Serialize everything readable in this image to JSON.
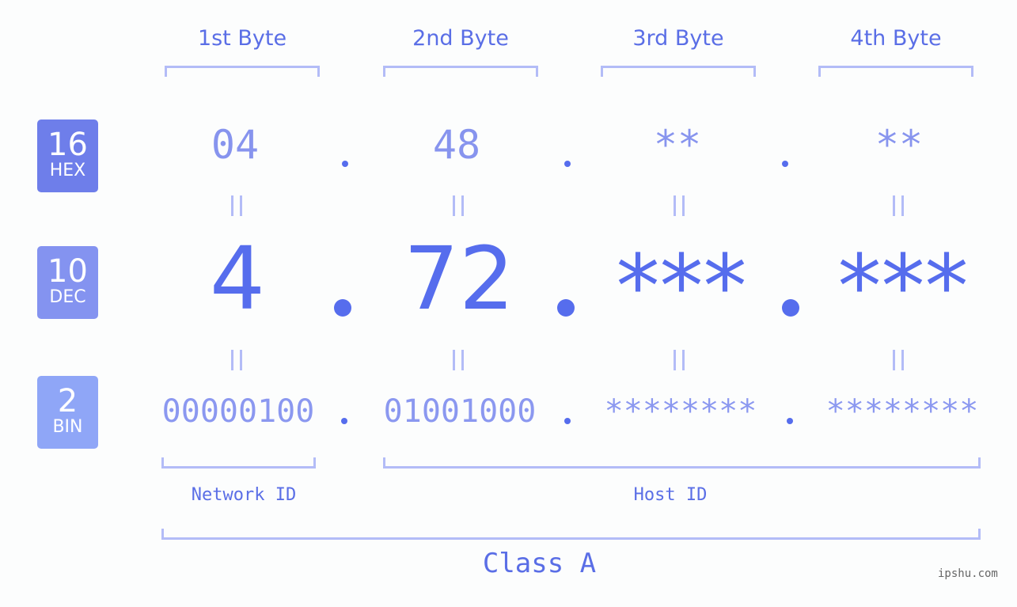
{
  "byte_headers": [
    "1st Byte",
    "2nd Byte",
    "3rd Byte",
    "4th Byte"
  ],
  "badges": {
    "hex": {
      "number": "16",
      "label": "HEX",
      "color": "#6e7eea"
    },
    "dec": {
      "number": "10",
      "label": "DEC",
      "color": "#8493f0"
    },
    "bin": {
      "number": "2",
      "label": "BIN",
      "color": "#8fa6f7"
    }
  },
  "hex_values": [
    "04",
    "48",
    "**",
    "**"
  ],
  "dec_values": [
    "4",
    "72",
    "***",
    "***"
  ],
  "bin_values": [
    "00000100",
    "01001000",
    "********",
    "********"
  ],
  "labels": {
    "network_id": "Network ID",
    "host_id": "Host ID",
    "class": "Class A"
  },
  "watermark": "ipshu.com",
  "colors": {
    "accent": "#566ded",
    "bracket": "#b3bcf7",
    "hex_text": "#8794ee",
    "bin_text": "#8b98f0"
  }
}
